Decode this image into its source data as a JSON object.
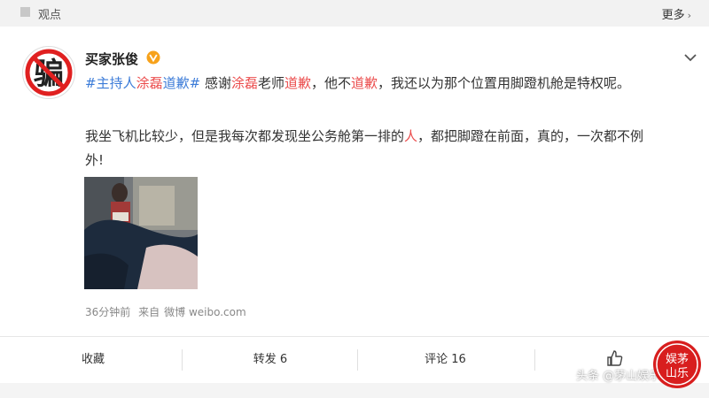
{
  "topbar": {
    "topic_label": "观点",
    "more_label": "更多"
  },
  "post": {
    "username": "买家张俊",
    "avatar_text": "骗",
    "line1_parts": [
      {
        "text": "#主持人",
        "style": "tag"
      },
      {
        "text": "涂磊",
        "style": "hl"
      },
      {
        "text": "道歉#",
        "style": "tag"
      },
      {
        "text": " 感谢",
        "style": "plain"
      },
      {
        "text": "涂磊",
        "style": "hl"
      },
      {
        "text": "老师",
        "style": "plain"
      },
      {
        "text": "道歉",
        "style": "hl"
      },
      {
        "text": "，他不",
        "style": "plain"
      },
      {
        "text": "道歉",
        "style": "hl"
      },
      {
        "text": "，我还以为那个位置用脚蹬机舱是特权呢。",
        "style": "plain"
      }
    ],
    "line2_parts": [
      {
        "text": "我坐飞机比较少，但是我每次都发现坐公务舱第一排的",
        "style": "plain"
      },
      {
        "text": "人",
        "style": "hl"
      },
      {
        "text": "，都把脚蹬在前面，真的，一次都不例",
        "style": "plain"
      }
    ],
    "line3": "外!",
    "meta": {
      "time": "36分钟前",
      "source_prefix": "来自",
      "source": "微博 weibo.com"
    }
  },
  "actions": {
    "collect": "收藏",
    "repost": "转发 6",
    "comment": "评论 16"
  },
  "watermark": {
    "text": "头条 @茅山娱乐",
    "seal_text": "娱茅山乐"
  },
  "colors": {
    "highlight": "#eb4c4c",
    "topic_blue": "#3b7bd8",
    "seal_red": "#d81e1e"
  }
}
